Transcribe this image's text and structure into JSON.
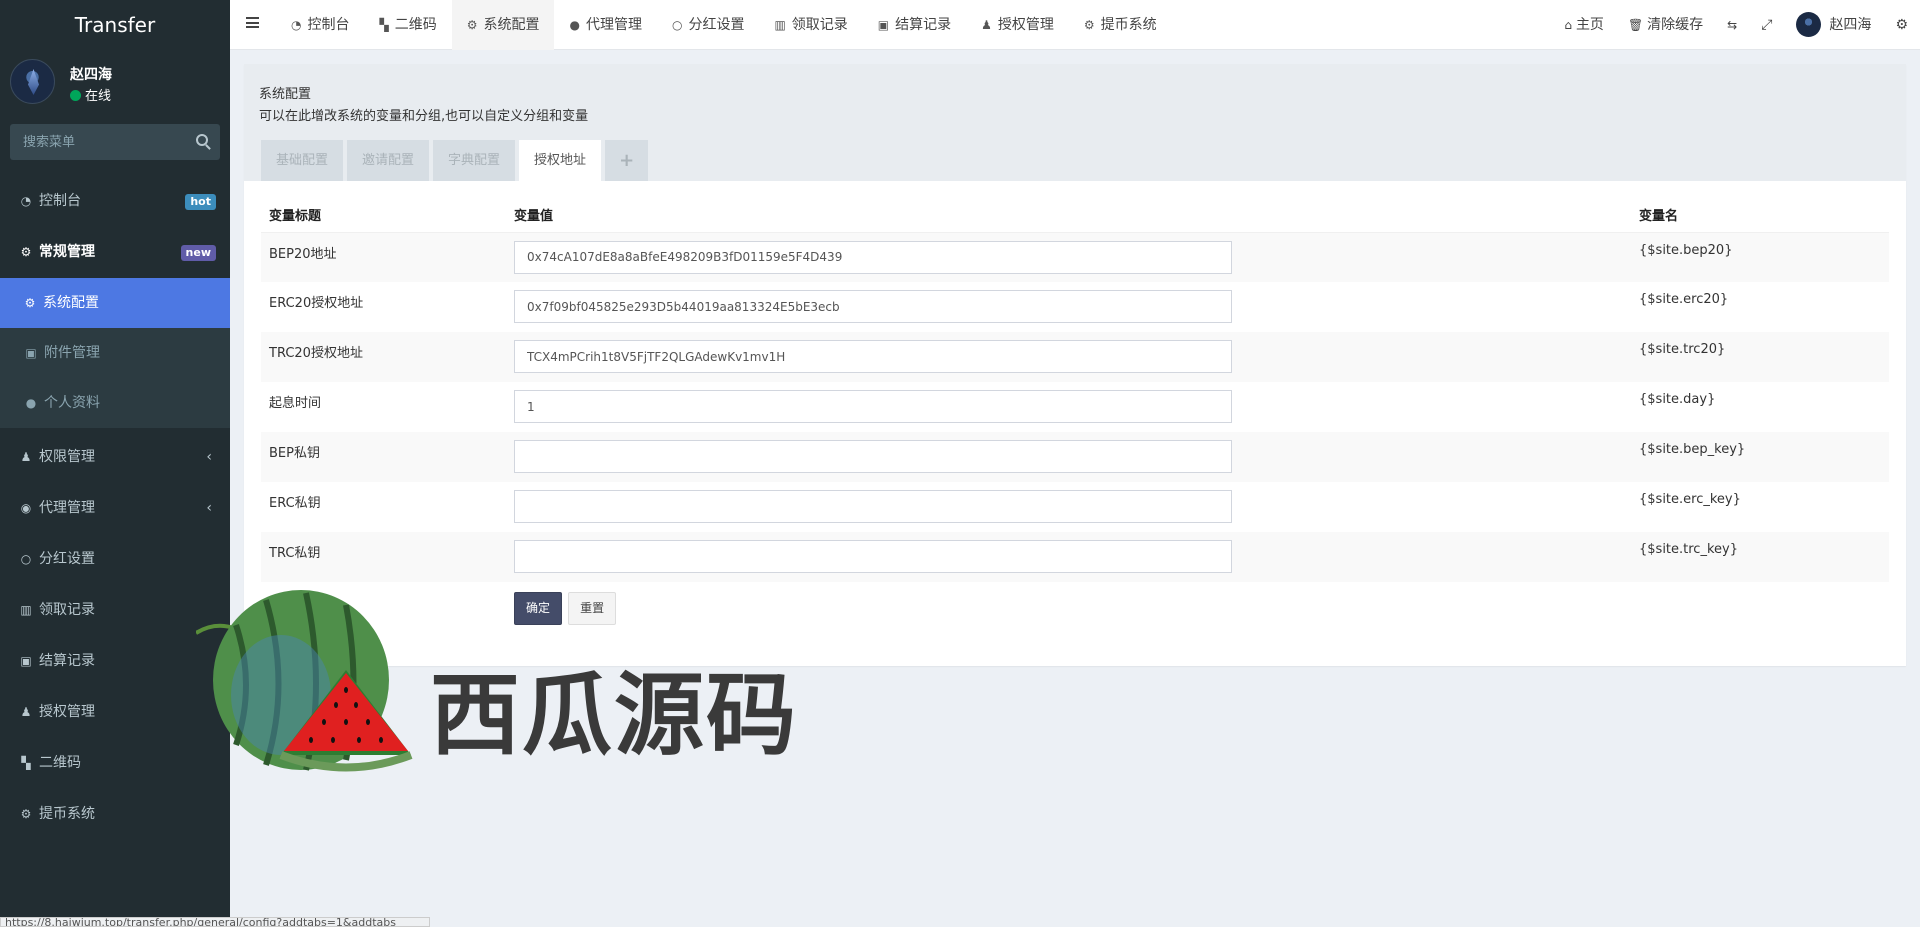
{
  "app": {
    "brand": "Transfer"
  },
  "user": {
    "name": "赵四海",
    "status": "在线"
  },
  "sidebar": {
    "search_placeholder": "搜索菜单",
    "items": [
      {
        "label": "控制台",
        "badge": "hot",
        "icon": "dashboard-icon"
      },
      {
        "label": "常规管理",
        "badge": "new",
        "icon": "cogs-icon"
      },
      {
        "label": "权限管理",
        "icon": "group-icon"
      },
      {
        "label": "代理管理",
        "icon": "user-circle-icon"
      },
      {
        "label": "分红设置",
        "icon": "circle-icon"
      },
      {
        "label": "领取记录",
        "icon": "bar-chart-icon"
      },
      {
        "label": "结算记录",
        "icon": "image-icon"
      },
      {
        "label": "授权管理",
        "icon": "group-icon"
      },
      {
        "label": "二维码",
        "icon": "qrcode-icon"
      },
      {
        "label": "提币系统",
        "icon": "gear-icon"
      }
    ],
    "subitems": [
      {
        "label": "系统配置",
        "icon": "gear-icon"
      },
      {
        "label": "附件管理",
        "icon": "image-icon"
      },
      {
        "label": "个人资料",
        "icon": "user-icon"
      }
    ]
  },
  "navbar": {
    "tabs": [
      {
        "label": "控制台",
        "icon": "dashboard-icon"
      },
      {
        "label": "二维码",
        "icon": "qrcode-icon"
      },
      {
        "label": "系统配置",
        "icon": "gear-icon"
      },
      {
        "label": "代理管理",
        "icon": "user-icon"
      },
      {
        "label": "分红设置",
        "icon": "circle-icon"
      },
      {
        "label": "领取记录",
        "icon": "bar-chart-icon"
      },
      {
        "label": "结算记录",
        "icon": "image-icon"
      },
      {
        "label": "授权管理",
        "icon": "group-icon"
      },
      {
        "label": "提币系统",
        "icon": "gear-icon"
      }
    ],
    "right": {
      "home": "主页",
      "clear_cache": "清除缓存",
      "user": "赵四海"
    }
  },
  "page": {
    "title": "系统配置",
    "description": "可以在此增改系统的变量和分组,也可以自定义分组和变量",
    "tabs": [
      "基础配置",
      "邀请配置",
      "字典配置",
      "授权地址",
      "+"
    ],
    "active_tab": "授权地址",
    "table": {
      "headers": [
        "变量标题",
        "变量值",
        "变量名"
      ],
      "rows": [
        {
          "title": "BEP20地址",
          "value": "0x74cA107dE8a8aBfeE498209B3fD01159e5F4D439",
          "name": "{$site.bep20}"
        },
        {
          "title": "ERC20授权地址",
          "value": "0x7f09bf045825e293D5b44019aa813324E5bE3ecb",
          "name": "{$site.erc20}"
        },
        {
          "title": "TRC20授权地址",
          "value": "TCX4mPCrih1t8V5FjTF2QLGAdewKv1mv1H",
          "name": "{$site.trc20}"
        },
        {
          "title": "起息时间",
          "value": "1",
          "name": "{$site.day}"
        },
        {
          "title": "BEP私钥",
          "value": "",
          "name": "{$site.bep_key}"
        },
        {
          "title": "ERC私钥",
          "value": "",
          "name": "{$site.erc_key}"
        },
        {
          "title": "TRC私钥",
          "value": "",
          "name": "{$site.trc_key}"
        }
      ]
    },
    "buttons": {
      "ok": "确定",
      "reset": "重置"
    }
  },
  "watermark": {
    "text": "西瓜源码"
  },
  "statusbar": {
    "url": "https://8.haiwjum.top/transfer.php/general/config?addtabs=1&addtabs"
  },
  "colors": {
    "sidebar_bg": "#222d32",
    "selected": "#4d78e3",
    "hot": "#3c8dbc",
    "new": "#605ca8",
    "ok_button": "#444c69"
  }
}
